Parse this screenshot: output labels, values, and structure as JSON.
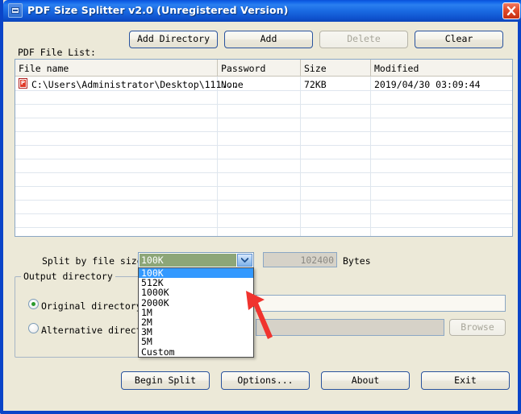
{
  "window": {
    "title": "PDF Size Splitter v2.0 (Unregistered Version)",
    "icon": "window-menu-icon",
    "close_icon": "close-icon",
    "border_color": "#0a44c8",
    "titlebar_color": "#1a6ae2",
    "background": "#ece9d8"
  },
  "toolbar": {
    "add_directory_label": "Add Directory",
    "add_label": "Add",
    "delete_label": "Delete",
    "delete_enabled": false,
    "clear_label": "Clear"
  },
  "file_list": {
    "caption": "PDF File List:",
    "columns": [
      "File name",
      "Password",
      "Size",
      "Modified"
    ],
    "rows": [
      {
        "icon": "pdf-file-icon",
        "file_name": "C:\\Users\\Administrator\\Desktop\\111...",
        "password": "None",
        "size": "72KB",
        "modified": "2019/04/30 03:09:44"
      }
    ]
  },
  "split": {
    "label": "Split by file size:",
    "selected_value": "100K",
    "dropdown_open": true,
    "options": [
      "100K",
      "512K",
      "1000K",
      "2000K",
      "1M",
      "2M",
      "3M",
      "5M",
      "Custom"
    ],
    "highlighted_option": "100K",
    "bytes_value": "102400",
    "bytes_enabled": false,
    "bytes_unit_label": "Bytes",
    "select_highlight_color": "#3399ff",
    "combo_selection_color": "#8da678"
  },
  "output_directory": {
    "group_title": "Output directory",
    "original_label": "Original directory",
    "original_selected": true,
    "original_path": "",
    "alternative_label": "Alternative directory",
    "alternative_selected": false,
    "alternative_path": "",
    "browse_label": "Browse",
    "browse_enabled": false
  },
  "footer": {
    "begin_split_label": "Begin Split",
    "options_label": "Options...",
    "about_label": "About",
    "exit_label": "Exit"
  },
  "annotation": {
    "arrow": "red-pointer-arrow",
    "color": "#f0332e"
  }
}
